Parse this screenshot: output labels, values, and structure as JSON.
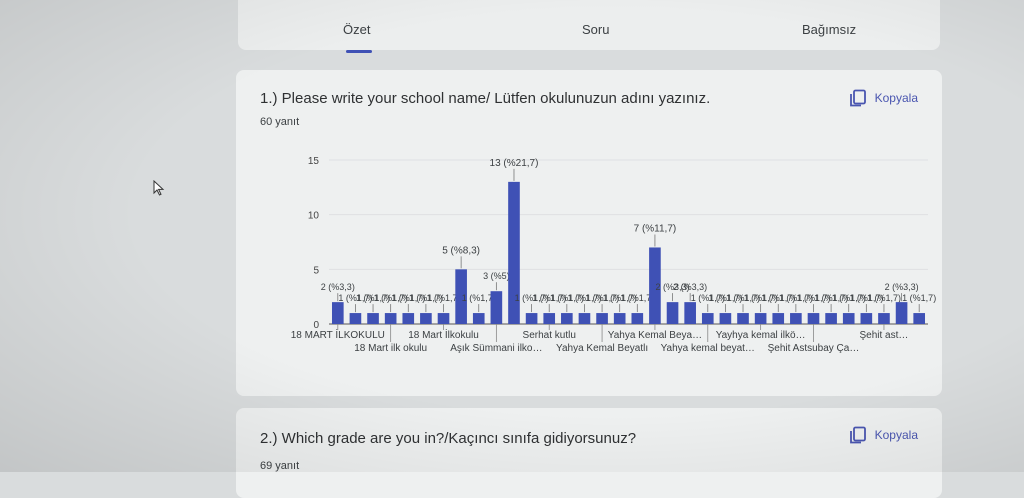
{
  "tabs": [
    {
      "label": "Özet",
      "active": true
    },
    {
      "label": "Soru",
      "active": false
    },
    {
      "label": "Bağımsız",
      "active": false
    }
  ],
  "questions": [
    {
      "title": "1.) Please write your school name/ Lütfen okulunuzun adını yazınız.",
      "count": "60 yanıt",
      "copy_label": "Kopyala"
    },
    {
      "title": "2.) Which grade are you in?/Kaçıncı sınıfa gidiyorsunuz?",
      "count": "69 yanıt",
      "copy_label": "Kopyala"
    }
  ],
  "colors": {
    "bar": "#3f51b5",
    "accent": "#3f51b5",
    "card": "#eef0f0",
    "background": "#d9dcdd"
  },
  "icons": {
    "copy": "copy-icon",
    "cursor": "mouse-cursor-icon"
  },
  "chart_data": {
    "type": "bar",
    "ylim": [
      0,
      15
    ],
    "yticks": [
      0,
      5,
      10,
      15
    ],
    "values": [
      2,
      1,
      1,
      1,
      1,
      1,
      1,
      5,
      1,
      3,
      13,
      1,
      1,
      1,
      1,
      1,
      1,
      1,
      7,
      2,
      2,
      1,
      1,
      1,
      1,
      1,
      1,
      1,
      1,
      1,
      1,
      1,
      2,
      1
    ],
    "bar_labels": [
      "2 (%3,3)",
      "1 (%1,7)",
      "1 (%1,7)",
      "1 (%1,7)",
      "1 (%1,7)",
      "1 (%1,7)",
      "1 (%1,7)",
      "5 (%8,3)",
      "1 (%1,7)",
      "3 (%5)",
      "13 (%21,7)",
      "1 (%1,7)",
      "1 (%1,7)",
      "1 (%1,7)",
      "1 (%1,7)",
      "1 (%1,7)",
      "1 (%1,7)",
      "1 (%1,7)",
      "7 (%11,7)",
      "2 (%3,3)",
      "2 (%3,3)",
      "1 (%1,7)",
      "1 (%1,7)",
      "1 (%1,7)",
      "1 (%1,7)",
      "1 (%1,7)",
      "1 (%1,7)",
      "1 (%1,7)",
      "1 (%1,7)",
      "1 (%1,7)",
      "1 (%1,7)",
      "1 (%1,7)",
      "2 (%3,3)",
      "1 (%1,7)"
    ],
    "x_tick_labels": [
      {
        "index": 0,
        "text": "18 MART İLKOKULU",
        "row": 1
      },
      {
        "index": 3,
        "text": "18 Mart ilk okulu",
        "row": 2
      },
      {
        "index": 6,
        "text": "18 Mart İlkokulu",
        "row": 1
      },
      {
        "index": 9,
        "text": "Aşık Sümmani ilko…",
        "row": 2
      },
      {
        "index": 12,
        "text": "Serhat kutlu",
        "row": 1
      },
      {
        "index": 15,
        "text": "Yahya Kemal Beyatlı",
        "row": 2
      },
      {
        "index": 18,
        "text": "Yahya Kemal Beya…",
        "row": 1
      },
      {
        "index": 21,
        "text": "Yahya kemal beyat…",
        "row": 2
      },
      {
        "index": 24,
        "text": "Yayhya kemal ilkö…",
        "row": 1
      },
      {
        "index": 27,
        "text": "Şehit Astsubay Ça…",
        "row": 2
      },
      {
        "index": 31,
        "text": "Şehit ast…",
        "row": 1
      }
    ]
  }
}
